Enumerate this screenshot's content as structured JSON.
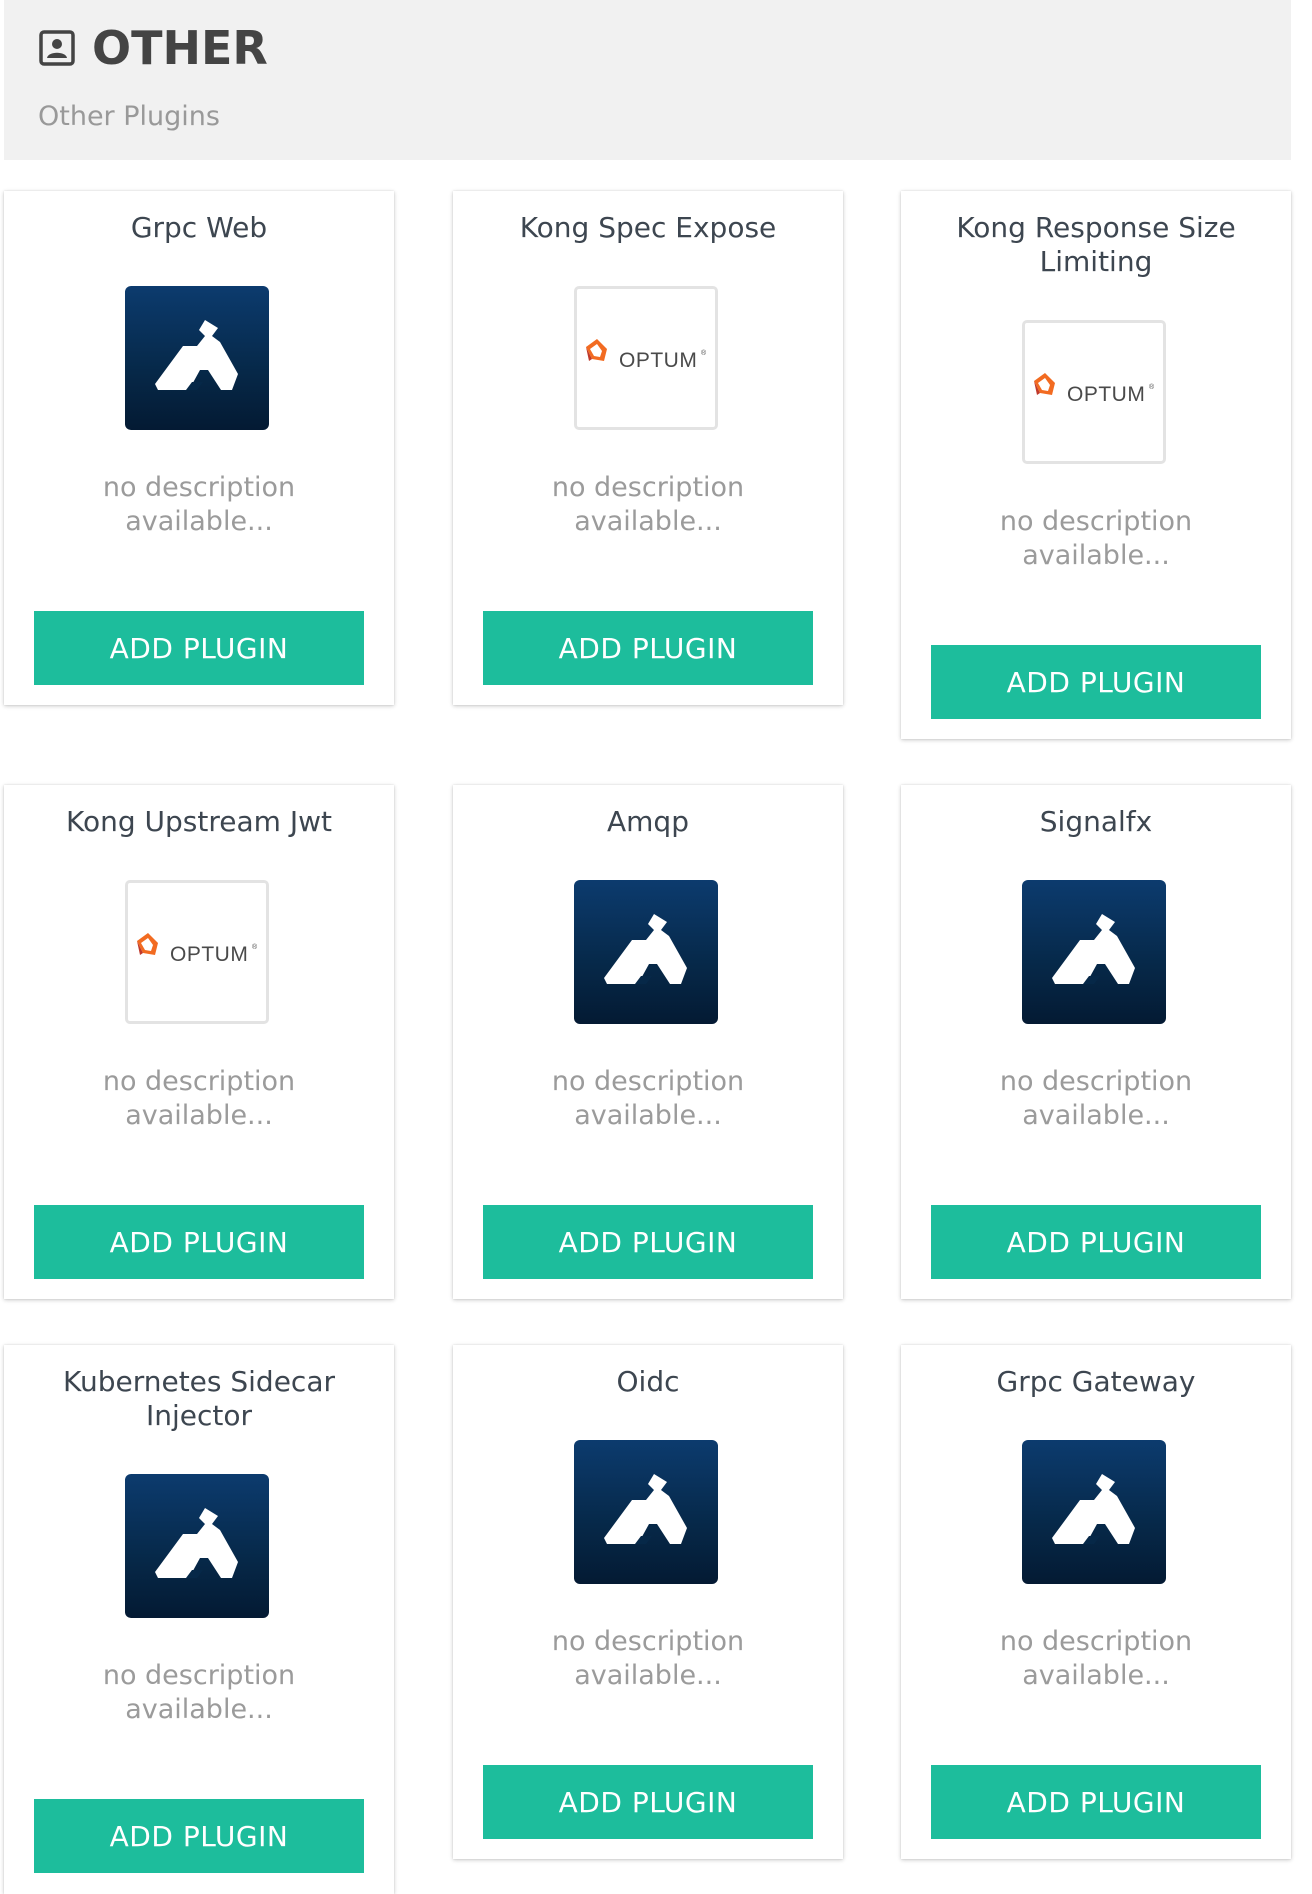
{
  "header": {
    "icon": "contact-card-icon",
    "title": "OTHER",
    "subtitle": "Other Plugins"
  },
  "cards": [
    {
      "title": "Grpc Web",
      "logo": "kong-gorilla-logo",
      "description": "no description available...",
      "button": "ADD PLUGIN"
    },
    {
      "title": "Kong Spec Expose",
      "logo": "optum-logo",
      "description": "no description available...",
      "button": "ADD PLUGIN"
    },
    {
      "title": "Kong Response Size Limiting",
      "logo": "optum-logo",
      "description": "no description available...",
      "button": "ADD PLUGIN"
    },
    {
      "title": "Kong Upstream Jwt",
      "logo": "optum-logo",
      "description": "no description available...",
      "button": "ADD PLUGIN"
    },
    {
      "title": "Amqp",
      "logo": "kong-gorilla-logo",
      "description": "no description available...",
      "button": "ADD PLUGIN"
    },
    {
      "title": "Signalfx",
      "logo": "kong-gorilla-logo",
      "description": "no description available...",
      "button": "ADD PLUGIN"
    },
    {
      "title": "Kubernetes Sidecar Injector",
      "logo": "kong-gorilla-logo",
      "description": "no description available...",
      "button": "ADD PLUGIN"
    },
    {
      "title": "Oidc",
      "logo": "kong-gorilla-logo",
      "description": "no description available...",
      "button": "ADD PLUGIN"
    },
    {
      "title": "Grpc Gateway",
      "logo": "kong-gorilla-logo",
      "description": "no description available...",
      "button": "ADD PLUGIN"
    }
  ],
  "optum_wordmark": "OPTUM",
  "colors": {
    "accent_button": "#1dbd9c",
    "header_bg": "#f1f1f1",
    "kong_logo_bg": "#062848",
    "optum_orange": "#f26b21"
  }
}
